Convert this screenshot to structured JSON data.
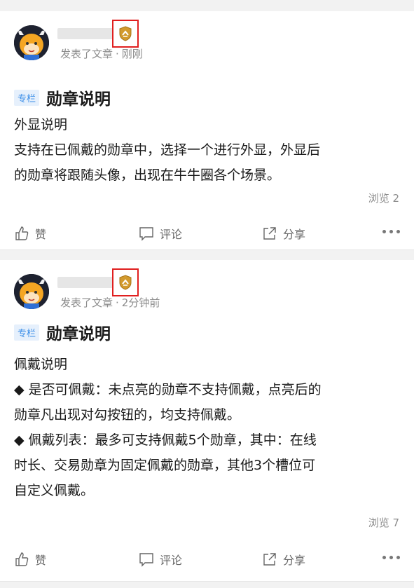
{
  "posts": [
    {
      "meta_action": "发表了文章",
      "meta_time": "刚刚",
      "tag": "专栏",
      "title": "勋章说明",
      "lines": [
        "外显说明",
        "支持在已佩戴的勋章中，选择一个进行外显，外显后",
        "的勋章将跟随头像，出现在牛牛圈各个场景。"
      ],
      "views": "浏览 2",
      "actions": {
        "like": "赞",
        "comment": "评论",
        "share": "分享"
      }
    },
    {
      "meta_action": "发表了文章",
      "meta_time": "2分钟前",
      "tag": "专栏",
      "title": "勋章说明",
      "lines": [
        "佩戴说明",
        "◆ 是否可佩戴：未点亮的勋章不支持佩戴，点亮后的",
        "勋章凡出现对勾按钮的，均支持佩戴。",
        "◆ 佩戴列表：最多可支持佩戴5个勋章，其中：在线",
        "时长、交易勋章为固定佩戴的勋章，其他3个槽位可",
        "自定义佩戴。"
      ],
      "views": "浏览 7",
      "actions": {
        "like": "赞",
        "comment": "评论",
        "share": "分享"
      }
    }
  ],
  "colors": {
    "tag_text": "#3b8ee8",
    "tag_bg": "#e6f0fc",
    "highlight_box": "#e01f1f",
    "badge_gold": "#d29a2e"
  }
}
